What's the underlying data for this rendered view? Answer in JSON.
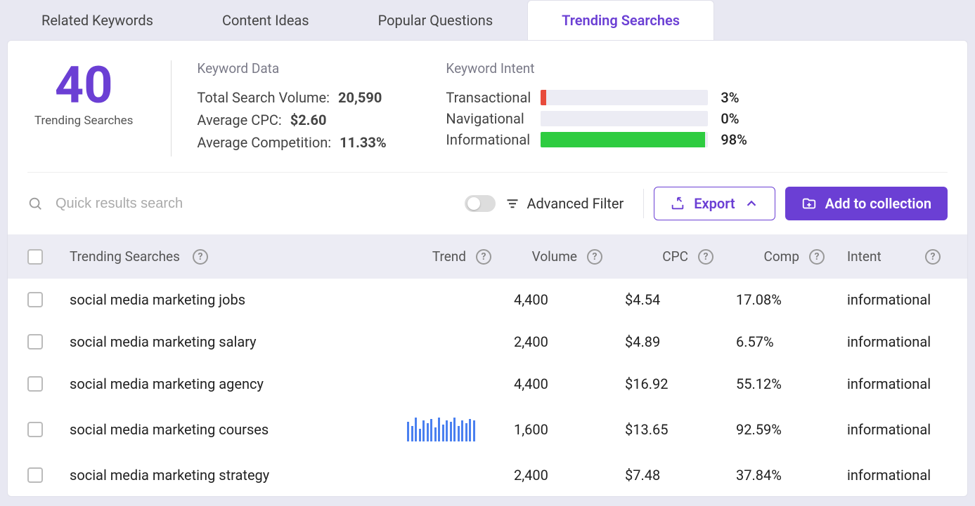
{
  "tabs": [
    {
      "label": "Related Keywords",
      "active": false
    },
    {
      "label": "Content Ideas",
      "active": false
    },
    {
      "label": "Popular Questions",
      "active": false
    },
    {
      "label": "Trending Searches",
      "active": true
    }
  ],
  "summary": {
    "count": "40",
    "count_label": "Trending Searches",
    "keyword_data_title": "Keyword Data",
    "stats": [
      {
        "label": "Total Search Volume:",
        "value": "20,590"
      },
      {
        "label": "Average CPC:",
        "value": "$2.60"
      },
      {
        "label": "Average Competition:",
        "value": "11.33%"
      }
    ],
    "intent_title": "Keyword Intent",
    "intents": [
      {
        "label": "Transactional",
        "pct": "3%",
        "width": 3,
        "color": "#e84b3c"
      },
      {
        "label": "Navigational",
        "pct": "0%",
        "width": 0,
        "color": "#999"
      },
      {
        "label": "Informational",
        "pct": "98%",
        "width": 98,
        "color": "#2ecc40"
      }
    ]
  },
  "toolbar": {
    "search_placeholder": "Quick results search",
    "advanced_filter_label": "Advanced Filter",
    "export_label": "Export",
    "add_label": "Add to collection"
  },
  "columns": {
    "name": "Trending Searches",
    "trend": "Trend",
    "volume": "Volume",
    "cpc": "CPC",
    "comp": "Comp",
    "intent": "Intent"
  },
  "rows": [
    {
      "keyword": "social media marketing jobs",
      "volume": "4,400",
      "cpc": "$4.54",
      "comp": "17.08%",
      "intent": "informational",
      "spark": null
    },
    {
      "keyword": "social media marketing salary",
      "volume": "2,400",
      "cpc": "$4.89",
      "comp": "6.57%",
      "intent": "informational",
      "spark": null
    },
    {
      "keyword": "social media marketing agency",
      "volume": "4,400",
      "cpc": "$16.92",
      "comp": "55.12%",
      "intent": "informational",
      "spark": null
    },
    {
      "keyword": "social media marketing courses",
      "volume": "1,600",
      "cpc": "$13.65",
      "comp": "92.59%",
      "intent": "informational",
      "spark": [
        28,
        22,
        34,
        18,
        30,
        26,
        32,
        20,
        34,
        24,
        30,
        28,
        34,
        22,
        30,
        26,
        32,
        30
      ]
    },
    {
      "keyword": "social media marketing strategy",
      "volume": "2,400",
      "cpc": "$7.48",
      "comp": "37.84%",
      "intent": "informational",
      "spark": null
    }
  ],
  "colors": {
    "accent": "#6b3fd4"
  }
}
